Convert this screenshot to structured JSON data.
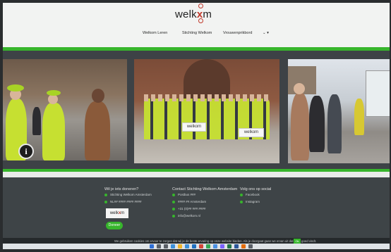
{
  "header": {
    "logo_prefix": "welk",
    "logo_mark": "x",
    "logo_suffix": "m",
    "nav": [
      {
        "label": "Welkom Leren"
      },
      {
        "label": "Stichting Welkom"
      },
      {
        "label": "Vrouwenprikbord"
      },
      {
        "label": "⌄ ▾"
      }
    ]
  },
  "gallery": {
    "banner_left": "welkom",
    "banner_right": "welkom"
  },
  "footer": {
    "col1": {
      "heading": "Wil je iets doneren?",
      "rows": [
        "Stichting Welkom Amsterdam",
        "NL## #### #### ####"
      ]
    },
    "col2": {
      "heading": "Contact Stichting Welkom Amsterdam",
      "rows": [
        "Postbus ###",
        "#### ## Amsterdam",
        "+31 (0)## ### ####",
        "info@welkom.nl"
      ]
    },
    "col3": {
      "heading": "Volg ons op social",
      "rows": [
        "Facebook",
        "Instagram"
      ]
    },
    "logo_prefix": "welk",
    "logo_mark": "x",
    "logo_suffix": "m",
    "donate_label": "Doneer",
    "cookie_text": "We gebruiken cookies om ervoor te zorgen dat wij je de beste ervaring op onze website bieden. Als je doorgaat gaan we ervan uit dat je dit goed vindt.",
    "cookie_ok": "Ok"
  },
  "colors": {
    "brand_green": "#37b52c",
    "logo_red": "#c0392b",
    "footer_bg": "#3e4447"
  },
  "icons": {
    "info": "info-icon"
  }
}
